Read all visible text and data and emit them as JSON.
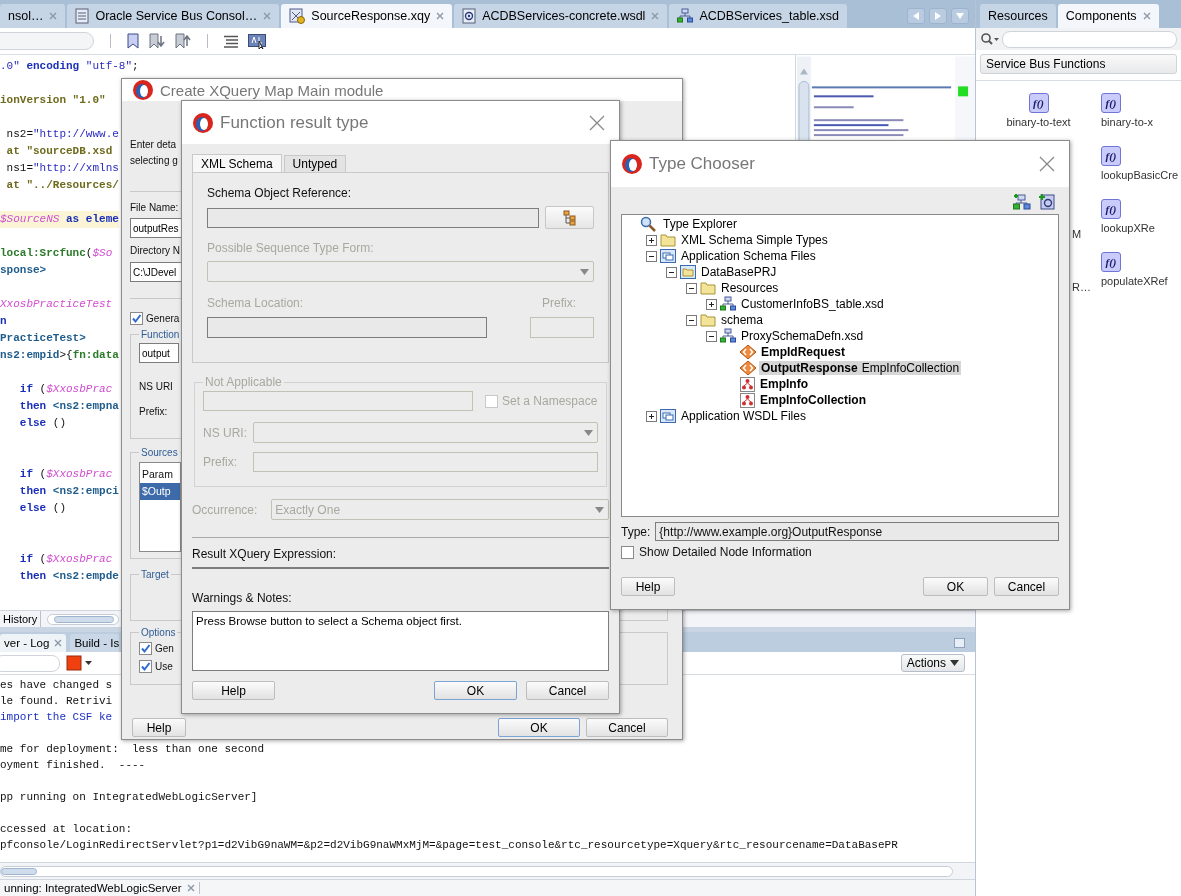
{
  "editor_tabs": [
    {
      "label": "nsol…",
      "kind": "none",
      "selected": false,
      "closable": true
    },
    {
      "label": "Oracle Service Bus Consol…",
      "kind": "page",
      "selected": false,
      "closable": true
    },
    {
      "label": "SourceResponse.xqy",
      "kind": "xquery",
      "selected": true,
      "closable": true
    },
    {
      "label": "ACDBServices-concrete.wsdl",
      "kind": "wsdl",
      "selected": false,
      "closable": true
    },
    {
      "label": "ACDBServices_table.xsd",
      "kind": "xsd",
      "selected": false,
      "closable": false
    }
  ],
  "code_lines": [
    {
      "kind": "code",
      "segments": [
        {
          "kind": "str",
          "text": ".0\""
        },
        {
          "kind": "kw",
          "text": " encoding"
        },
        {
          "kind": "str",
          "text": " \"utf-8\""
        },
        {
          "kind": "plain",
          "text": ";"
        }
      ]
    },
    {
      "kind": "blank"
    },
    {
      "kind": "code",
      "segments": [
        {
          "kind": "pragma",
          "text": "ionVersion"
        },
        {
          "kind": "pstr",
          "text": " \"1.0\""
        }
      ]
    },
    {
      "kind": "blank"
    },
    {
      "kind": "code",
      "segments": [
        {
          "kind": "plain",
          "text": " ns2="
        },
        {
          "kind": "str",
          "text": "\"http://www.e"
        }
      ]
    },
    {
      "kind": "code",
      "segments": [
        {
          "kind": "pragma",
          "text": " at"
        },
        {
          "kind": "pstr",
          "text": " \"sourceDB.xsd"
        }
      ]
    },
    {
      "kind": "code",
      "segments": [
        {
          "kind": "plain",
          "text": " ns1="
        },
        {
          "kind": "str",
          "text": "\"http://xmlns"
        }
      ]
    },
    {
      "kind": "code",
      "segments": [
        {
          "kind": "pragma",
          "text": " at"
        },
        {
          "kind": "pstr",
          "text": " \"../Resources/"
        }
      ]
    },
    {
      "kind": "blank"
    },
    {
      "kind": "code",
      "highlighted": true,
      "segments": [
        {
          "kind": "var",
          "text": "$SourceNS"
        },
        {
          "kind": "kw",
          "text": " as eleme"
        }
      ]
    },
    {
      "kind": "blank"
    },
    {
      "kind": "code",
      "segments": [
        {
          "kind": "fn",
          "text": "local:Srcfunc"
        },
        {
          "kind": "plain",
          "text": "("
        },
        {
          "kind": "var",
          "text": "$So"
        }
      ]
    },
    {
      "kind": "code",
      "segments": [
        {
          "kind": "tag",
          "text": "sponse>"
        }
      ]
    },
    {
      "kind": "blank"
    },
    {
      "kind": "code",
      "segments": [
        {
          "kind": "var",
          "text": "XxosbPracticeTest"
        }
      ]
    },
    {
      "kind": "code",
      "segments": [
        {
          "kind": "kw",
          "text": "n"
        }
      ]
    },
    {
      "kind": "code",
      "segments": [
        {
          "kind": "tag",
          "text": "PracticeTest>"
        }
      ]
    },
    {
      "kind": "code",
      "segments": [
        {
          "kind": "tag",
          "text": "ns2:empid"
        },
        {
          "kind": "plain",
          "text": ">{"
        },
        {
          "kind": "fn",
          "text": "fn:data"
        }
      ]
    },
    {
      "kind": "blank"
    },
    {
      "kind": "code",
      "segments": [
        {
          "kind": "kw",
          "text": "   if"
        },
        {
          "kind": "plain",
          "text": " ("
        },
        {
          "kind": "var",
          "text": "$XxosbPrac"
        }
      ]
    },
    {
      "kind": "code",
      "segments": [
        {
          "kind": "kw",
          "text": "   then"
        },
        {
          "kind": "tag",
          "text": " <ns2:empna"
        }
      ]
    },
    {
      "kind": "code",
      "segments": [
        {
          "kind": "kw",
          "text": "   else"
        },
        {
          "kind": "plain",
          "text": " ()"
        }
      ]
    },
    {
      "kind": "blank"
    },
    {
      "kind": "blank"
    },
    {
      "kind": "code",
      "segments": [
        {
          "kind": "kw",
          "text": "   if"
        },
        {
          "kind": "plain",
          "text": " ("
        },
        {
          "kind": "var",
          "text": "$XxosbPrac"
        }
      ]
    },
    {
      "kind": "code",
      "segments": [
        {
          "kind": "kw",
          "text": "   then"
        },
        {
          "kind": "tag",
          "text": " <ns2:empci"
        }
      ]
    },
    {
      "kind": "code",
      "segments": [
        {
          "kind": "kw",
          "text": "   else"
        },
        {
          "kind": "plain",
          "text": " ()"
        }
      ]
    },
    {
      "kind": "blank"
    },
    {
      "kind": "blank"
    },
    {
      "kind": "code",
      "segments": [
        {
          "kind": "kw",
          "text": "   if"
        },
        {
          "kind": "plain",
          "text": " ("
        },
        {
          "kind": "var",
          "text": "$XxosbPrac"
        }
      ]
    },
    {
      "kind": "code",
      "segments": [
        {
          "kind": "kw",
          "text": "   then"
        },
        {
          "kind": "tag",
          "text": " <ns2:empde"
        }
      ]
    }
  ],
  "history_tab": "History",
  "log": {
    "tabs": [
      {
        "label": "ver - Log",
        "selected": true,
        "closable": true
      },
      {
        "label": "Build - Is",
        "selected": false,
        "closable": false
      }
    ],
    "actions": "Actions",
    "lines": [
      {
        "kind": "plain",
        "text": "es have changed s"
      },
      {
        "kind": "plain",
        "text": "le found. Retrivi"
      },
      {
        "kind": "info",
        "text": "import the CSF ke"
      },
      {
        "kind": "blank"
      },
      {
        "kind": "plain",
        "text": "me for deployment:  less than one second"
      },
      {
        "kind": "plain",
        "text": "oyment finished.  ----"
      },
      {
        "kind": "blank"
      },
      {
        "kind": "plain",
        "text": "pp running on IntegratedWebLogicServer]"
      },
      {
        "kind": "blank"
      },
      {
        "kind": "plain",
        "text": "ccessed at location:"
      },
      {
        "kind": "plain",
        "text": "pfconsole/LoginRedirectServlet?p1=d2VibG9naWM=&p2=d2VibG9naWMxMjM=&page=test_console&rtc_resourcetype=Xquery&rtc_resourcename=DataBasePR"
      }
    ]
  },
  "status_tab": "unning: IntegratedWebLogicServer",
  "right_panel": {
    "tabs": [
      {
        "label": "Resources",
        "selected": false,
        "closable": false
      },
      {
        "label": "Components",
        "selected": true,
        "closable": true
      }
    ],
    "section": "Service Bus Functions",
    "rows": [
      {
        "left": {
          "label": "binary-to-text",
          "glyph": "f()"
        },
        "right": {
          "label": "binary-to-x",
          "glyph": "f()"
        }
      },
      {
        "right": {
          "label": "lookupBasicCre",
          "glyph": "f()"
        }
      },
      {
        "left": {
          "label": "M"
        },
        "right": {
          "label": "lookupXRe",
          "glyph": "f()"
        }
      },
      {
        "left": {
          "label": "R…"
        },
        "right": {
          "label": "populateXRef",
          "glyph": "f()"
        }
      }
    ]
  },
  "create_dialog": {
    "title": "Create XQuery Map Main module",
    "intro": [
      "Enter deta",
      "selecting g"
    ],
    "file_name_label": "File Name:",
    "file_name_value": "outputRes",
    "directory_label": "Directory N",
    "directory_value": "C:\\JDevel",
    "generate": {
      "label": "Genera",
      "checked": true
    },
    "function_group": {
      "title": "Function",
      "value": "output",
      "ns_uri_label": "NS URI",
      "prefix_label": "Prefix:"
    },
    "sources": {
      "title": "Sources",
      "items": [
        {
          "label": "Param",
          "selected": false
        },
        {
          "label": "$Outp",
          "selected": true
        }
      ]
    },
    "target_title": "Target",
    "options": {
      "title": "Options",
      "checkboxes": [
        {
          "label": "Gen",
          "checked": true
        },
        {
          "label": "Use",
          "checked": true
        }
      ]
    },
    "buttons": [
      {
        "label": "Help",
        "default": false
      },
      {
        "label": "OK",
        "default": true
      },
      {
        "label": "Cancel",
        "default": false
      }
    ]
  },
  "function_dialog": {
    "title": "Function result type",
    "tabs": [
      {
        "label": "XML Schema",
        "selected": true
      },
      {
        "label": "Untyped",
        "selected": false
      }
    ],
    "schema_ref": {
      "label": "Schema Object Reference:",
      "disabled": false
    },
    "sequence_form": {
      "label": "Possible Sequence Type Form:",
      "disabled": true
    },
    "schema_location": {
      "label": "Schema Location:",
      "disabled": true
    },
    "prefix": {
      "label": "Prefix:",
      "disabled": true
    },
    "not_applicable": {
      "title": "Not Applicable",
      "disabled": true,
      "set_namespace": {
        "label": "Set a Namespace",
        "checked": false
      },
      "ns_uri_label": "NS URI:",
      "prefix_label": "Prefix:"
    },
    "occurrence": {
      "label": "Occurrence:",
      "value": "Exactly One",
      "disabled": true
    },
    "result_label": "Result XQuery Expression:",
    "warnings_label": "Warnings & Notes:",
    "warnings_text": "Press Browse button to select a Schema object first.",
    "buttons": [
      {
        "label": "Help",
        "default": false
      },
      {
        "label": "OK",
        "default": true
      },
      {
        "label": "Cancel",
        "default": false
      }
    ]
  },
  "type_chooser": {
    "title": "Type Chooser",
    "tree": [
      {
        "label": "Type Explorer",
        "kind": "search",
        "selected": false,
        "children": [
          {
            "label": "XML Schema Simple Types",
            "kind": "folder",
            "expanded": false,
            "selected": false
          },
          {
            "label": "Application Schema Files",
            "kind": "app",
            "expanded": true,
            "selected": false,
            "children": [
              {
                "label": "DataBasePRJ",
                "kind": "project",
                "expanded": true,
                "selected": false,
                "children": [
                  {
                    "label": "Resources",
                    "kind": "folder",
                    "expanded": true,
                    "selected": false,
                    "children": [
                      {
                        "label": "CustomerInfoBS_table.xsd",
                        "kind": "xsd",
                        "expanded": false,
                        "selected": false
                      }
                    ]
                  },
                  {
                    "label": "schema",
                    "kind": "folder",
                    "expanded": true,
                    "selected": false,
                    "children": [
                      {
                        "label": "ProxySchemaDefn.xsd",
                        "kind": "xsd",
                        "expanded": true,
                        "selected": false,
                        "children": [
                          {
                            "label": "EmpIdRequest",
                            "kind": "element",
                            "selected": false
                          },
                          {
                            "label": "OutputResponse",
                            "type_name": "EmpInfoCollection",
                            "kind": "element",
                            "selected": true
                          },
                          {
                            "label": "EmpInfo",
                            "kind": "complex",
                            "selected": false
                          },
                          {
                            "label": "EmpInfoCollection",
                            "kind": "complex",
                            "selected": false
                          }
                        ]
                      }
                    ]
                  }
                ]
              }
            ]
          },
          {
            "label": "Application WSDL Files",
            "kind": "app",
            "expanded": false,
            "selected": false
          }
        ]
      }
    ],
    "type_label": "Type:",
    "type_value": "{http://www.example.org}OutputResponse",
    "show_detail": {
      "label": "Show Detailed Node Information",
      "checked": false
    },
    "buttons": [
      {
        "label": "Help",
        "default": false
      },
      {
        "label": "OK",
        "default": false
      },
      {
        "label": "Cancel",
        "default": false
      }
    ]
  }
}
